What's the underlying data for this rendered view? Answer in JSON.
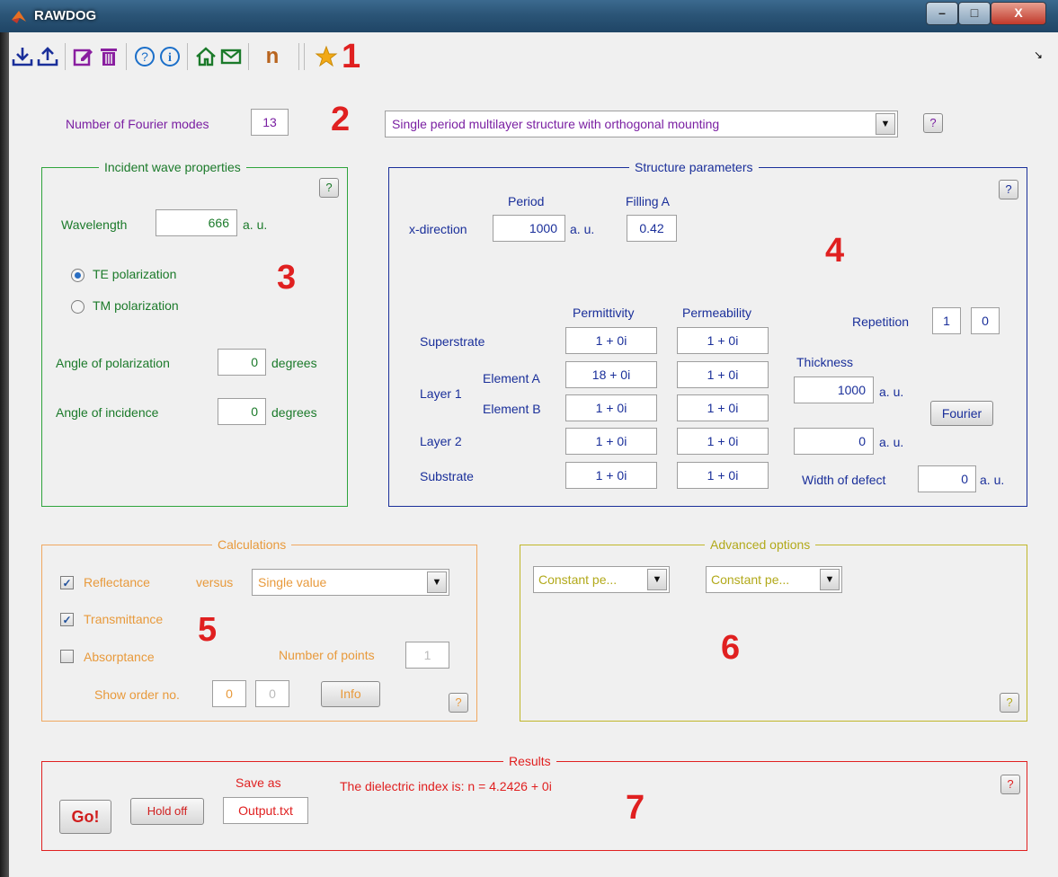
{
  "window": {
    "title": "RAWDOG",
    "min": "–",
    "max": "□",
    "close": "X",
    "resize_glyph": "↘"
  },
  "toolbar": {
    "icons": [
      "download-icon",
      "upload-icon",
      "edit-icon",
      "trash-icon",
      "help-icon",
      "info-icon",
      "home-icon",
      "mail-icon",
      "n-icon",
      "star-icon"
    ],
    "n_label": "n"
  },
  "markers": {
    "m1": "1",
    "m2": "2",
    "m3": "3",
    "m4": "4",
    "m5": "5",
    "m6": "6",
    "m7": "7"
  },
  "top": {
    "fourier_label": "Number of Fourier modes",
    "fourier_value": "13",
    "structure_select": "Single period multilayer structure with orthogonal mounting",
    "help": "?"
  },
  "incident": {
    "title": "Incident wave properties",
    "help": "?",
    "wavelength_label": "Wavelength",
    "wavelength_value": "666",
    "unit": "a. u.",
    "te_label": "TE polarization",
    "tm_label": "TM polarization",
    "te_selected": true,
    "pol_angle_label": "Angle of polarization",
    "pol_angle_value": "0",
    "inc_angle_label": "Angle of incidence",
    "inc_angle_value": "0",
    "degrees": "degrees"
  },
  "structure": {
    "title": "Structure parameters",
    "help": "?",
    "period_label": "Period",
    "filling_label": "Filling A",
    "xdir_label": "x-direction",
    "period_value": "1000",
    "unit": "a. u.",
    "filling_value": "0.42",
    "permittivity_label": "Permittivity",
    "permeability_label": "Permeability",
    "repetition_label": "Repetition",
    "repetition_1": "1",
    "repetition_2": "0",
    "thickness_label": "Thickness",
    "superstrate_label": "Superstrate",
    "layer1_label": "Layer 1",
    "elementA_label": "Element A",
    "elementB_label": "Element B",
    "layer2_label": "Layer 2",
    "substrate_label": "Substrate",
    "superstrate_perm": "1 + 0i",
    "superstrate_mu": "1 + 0i",
    "elA_perm": "18 + 0i",
    "elA_mu": "1 + 0i",
    "elB_perm": "1 + 0i",
    "elB_mu": "1 + 0i",
    "layer2_perm": "1 + 0i",
    "layer2_mu": "1 + 0i",
    "substrate_perm": "1 + 0i",
    "substrate_mu": "1 + 0i",
    "layer1_thickness": "1000",
    "layer2_thickness": "0",
    "fourier_button": "Fourier",
    "defect_label": "Width of defect",
    "defect_value": "0"
  },
  "calc": {
    "title": "Calculations",
    "reflectance": "Reflectance",
    "transmittance": "Transmittance",
    "absorptance": "Absorptance",
    "reflectance_checked": true,
    "transmittance_checked": true,
    "absorptance_checked": false,
    "versus_label": "versus",
    "versus_value": "Single value",
    "points_label": "Number of points",
    "points_value": "1",
    "order_label": "Show order no.",
    "order_1": "0",
    "order_2": "0",
    "info_button": "Info",
    "help": "?"
  },
  "advanced": {
    "title": "Advanced options",
    "select1": "Constant pe...",
    "select2": "Constant pe...",
    "help": "?"
  },
  "results": {
    "title": "Results",
    "go_button": "Go!",
    "hold_button": "Hold off",
    "save_label": "Save as",
    "save_value": "Output.txt",
    "message": "The dielectric index is: n = 4.2426 + 0i",
    "help": "?"
  },
  "colors": {
    "purple": "#7a1fa2",
    "green": "#1b7a2a",
    "blue": "#1a2f9a",
    "orange": "#e89a3c",
    "olive": "#b2a91a",
    "red": "#e02020"
  }
}
